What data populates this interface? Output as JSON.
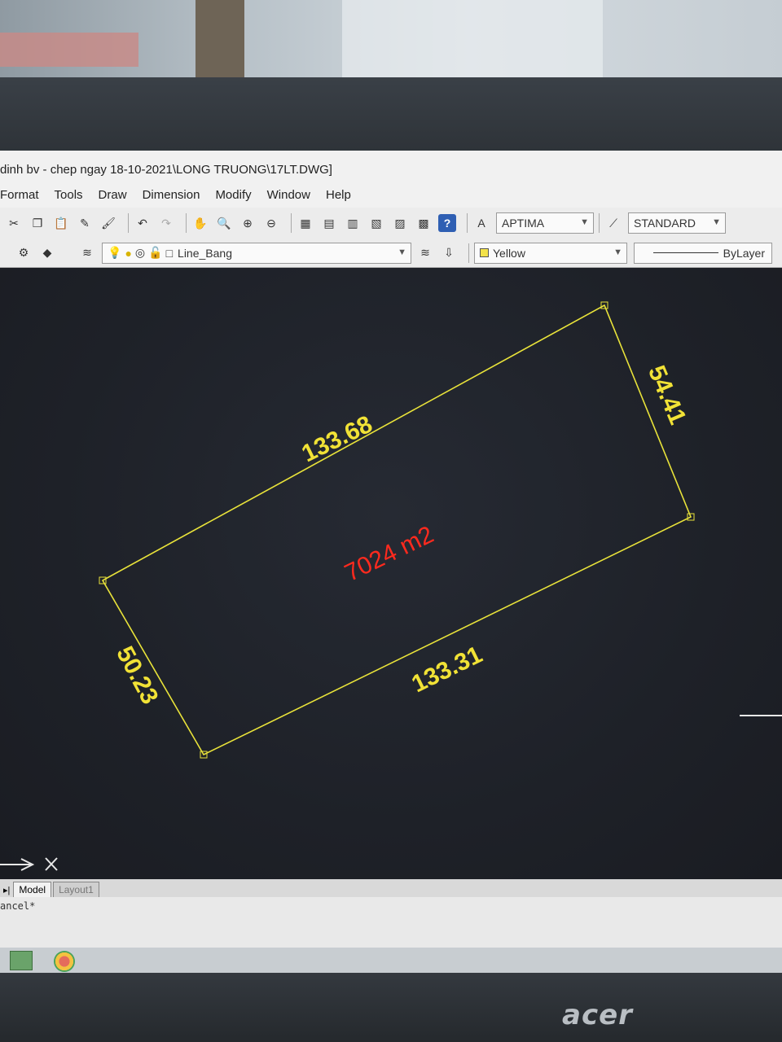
{
  "window": {
    "title": "dinh bv - chep ngay 18-10-2021\\LONG TRUONG\\17LT.DWG]"
  },
  "menu": [
    "Format",
    "Tools",
    "Draw",
    "Dimension",
    "Modify",
    "Window",
    "Help"
  ],
  "toolbar": {
    "text_style": "APTIMA",
    "dim_style": "STANDARD",
    "layer": "Line_Bang",
    "color": "Yellow",
    "color_hex": "#f3e24a",
    "linetype": "ByLayer"
  },
  "drawing": {
    "edge_top": "133.68",
    "edge_right": "54.41",
    "edge_bottom": "133.31",
    "edge_left": "50.23",
    "area": "7024 m2",
    "line_color": "#e9e33a",
    "area_color": "#ff2a1e"
  },
  "tabs": [
    "Model",
    "Layout1"
  ],
  "command_line": "ancel*",
  "monitor_brand": "acer"
}
